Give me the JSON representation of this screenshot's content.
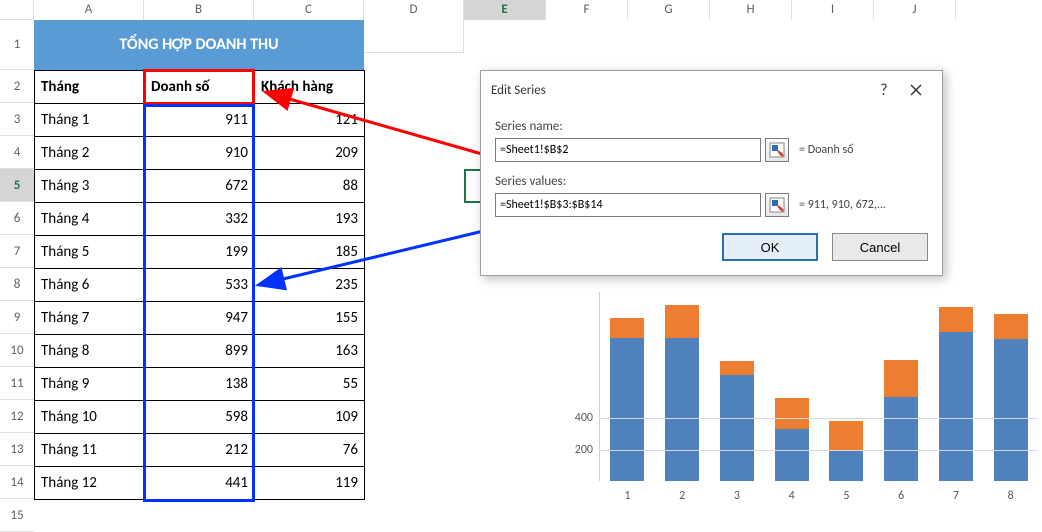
{
  "col_widths": {
    "A": 110,
    "B": 110,
    "C": 110,
    "D": 100,
    "E": 82,
    "F": 82,
    "G": 82,
    "H": 82,
    "I": 82,
    "J": 82
  },
  "column_letters": [
    "A",
    "B",
    "C",
    "D",
    "E",
    "F",
    "G",
    "H",
    "I",
    "J"
  ],
  "row_numbers": [
    "1",
    "2",
    "3",
    "4",
    "5",
    "6",
    "7",
    "8",
    "9",
    "10",
    "11",
    "12",
    "13",
    "14",
    "15"
  ],
  "selected_column": "E",
  "selected_row": "5",
  "title": "TỔNG HỢP DOANH THU",
  "headers": {
    "month": "Tháng",
    "revenue": "Doanh số",
    "customers": "Khách hàng"
  },
  "rows": [
    {
      "m": "Tháng 1",
      "r": "911",
      "c": "121"
    },
    {
      "m": "Tháng 2",
      "r": "910",
      "c": "209"
    },
    {
      "m": "Tháng 3",
      "r": "672",
      "c": "88"
    },
    {
      "m": "Tháng 4",
      "r": "332",
      "c": "193"
    },
    {
      "m": "Tháng 5",
      "r": "199",
      "c": "185"
    },
    {
      "m": "Tháng 6",
      "r": "533",
      "c": "235"
    },
    {
      "m": "Tháng 7",
      "r": "947",
      "c": "155"
    },
    {
      "m": "Tháng 8",
      "r": "899",
      "c": "163"
    },
    {
      "m": "Tháng 9",
      "r": "138",
      "c": "55"
    },
    {
      "m": "Tháng 10",
      "r": "598",
      "c": "109"
    },
    {
      "m": "Tháng 11",
      "r": "212",
      "c": "76"
    },
    {
      "m": "Tháng 12",
      "r": "441",
      "c": "119"
    }
  ],
  "dialog": {
    "title": "Edit Series",
    "label_name": "Series name:",
    "input_name": "=Sheet1!$B$2",
    "preview_name": "= Doanh số",
    "label_values": "Series values:",
    "input_values": "=Sheet1!$B$3:$B$14",
    "preview_values": "= 911, 910, 672,...",
    "ok": "OK",
    "cancel": "Cancel"
  },
  "chart_data": {
    "type": "bar",
    "categories": [
      "1",
      "2",
      "3",
      "4",
      "5",
      "6",
      "7",
      "8"
    ],
    "series": [
      {
        "name": "Doanh số",
        "values": [
          911,
          910,
          672,
          332,
          199,
          533,
          947,
          899
        ],
        "color": "#4f81bd"
      },
      {
        "name": "Khách hàng",
        "values": [
          121,
          209,
          88,
          193,
          185,
          235,
          155,
          163
        ],
        "color": "#ed7d31"
      }
    ],
    "yticks": [
      200,
      400
    ],
    "ymax": 1200,
    "ylabel": "",
    "xlabel": "",
    "title": ""
  },
  "colors": {
    "red": "#ff0000",
    "blue": "#0033ff"
  }
}
